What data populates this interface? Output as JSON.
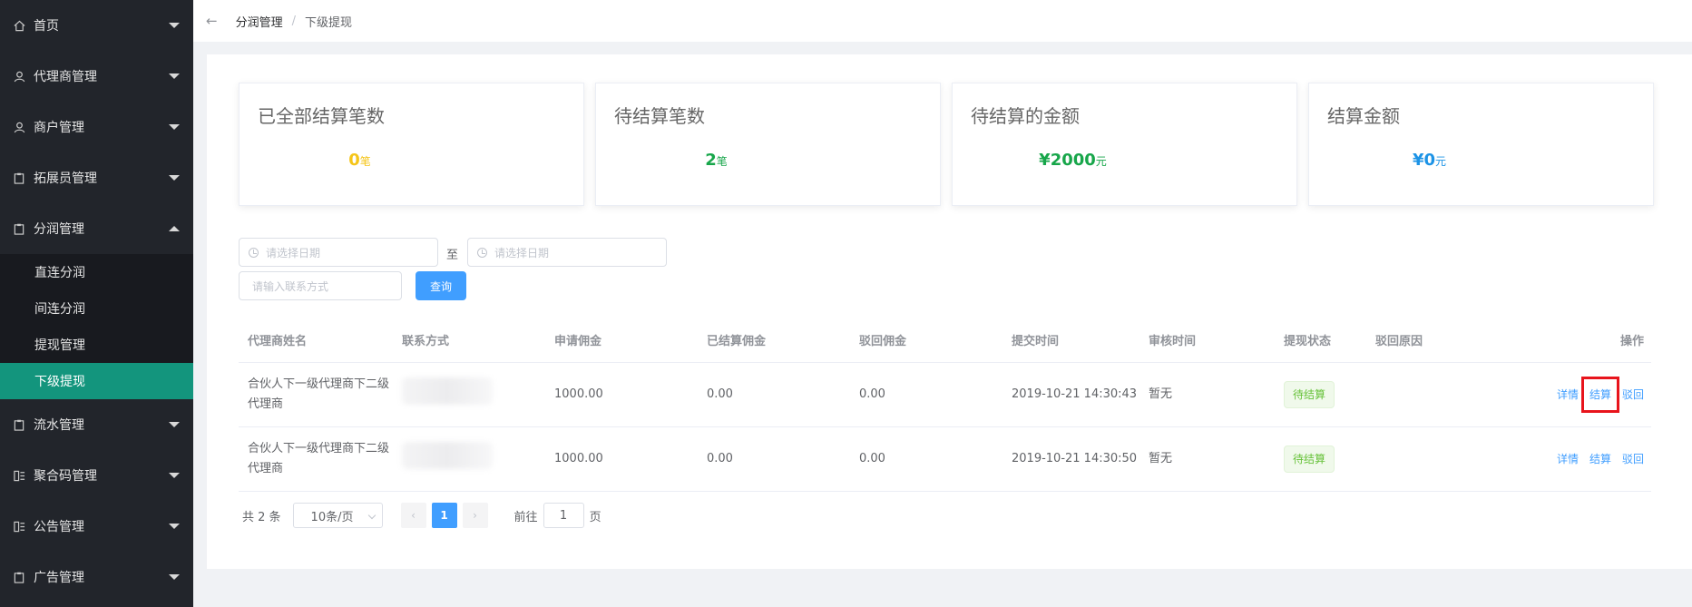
{
  "sidebar": {
    "menu_home": "首页",
    "menu_agent": "代理商管理",
    "menu_merchant": "商户管理",
    "menu_promoter": "拓展员管理",
    "menu_profit": "分润管理",
    "submenu": [
      "直连分润",
      "间连分润",
      "提现管理",
      "下级提现"
    ],
    "menu_flow": "流水管理",
    "menu_qrcode": "聚合码管理",
    "menu_notice": "公告管理",
    "menu_ads": "广告管理"
  },
  "breadcrumb": {
    "back_icon": "←",
    "parent": "分润管理",
    "separator": "/",
    "current": "下级提现"
  },
  "stats": [
    {
      "title": "已全部结算笔数",
      "value": "0",
      "unit": "笔",
      "color": "#f5c518"
    },
    {
      "title": "待结算笔数",
      "value": "2",
      "unit": "笔",
      "color": "#17a64a"
    },
    {
      "title": "待结算的金额",
      "value": "¥2000",
      "unit": "元",
      "color": "#17a64a"
    },
    {
      "title": "结算金额",
      "value": "¥0",
      "unit": "元",
      "color": "#1c93e6"
    }
  ],
  "filters": {
    "start_date_placeholder": "请选择日期",
    "to_label": "至",
    "end_date_placeholder": "请选择日期",
    "contact_placeholder": "请输入联系方式",
    "query_button": "查询"
  },
  "table": {
    "headers": [
      "代理商姓名",
      "联系方式",
      "申请佣金",
      "已结算佣金",
      "驳回佣金",
      "提交时间",
      "审核时间",
      "提现状态",
      "驳回原因",
      "操作"
    ],
    "rows": [
      {
        "name": "合伙人下一级代理商下二级代理商",
        "apply": "1000.00",
        "settled": "0.00",
        "rejected": "0.00",
        "submit_time": "2019-10-21 14:30:43",
        "review_time": "暂无",
        "status": "待结算",
        "reason": "",
        "op_detail": "详情",
        "op_settle": "结算",
        "op_reject": "驳回"
      },
      {
        "name": "合伙人下一级代理商下二级代理商",
        "apply": "1000.00",
        "settled": "0.00",
        "rejected": "0.00",
        "submit_time": "2019-10-21 14:30:50",
        "review_time": "暂无",
        "status": "待结算",
        "reason": "",
        "op_detail": "详情",
        "op_settle": "结算",
        "op_reject": "驳回"
      }
    ]
  },
  "pagination": {
    "total_text": "共 2 条",
    "page_size": "10条/页",
    "prev": "‹",
    "current_page": "1",
    "next": "›",
    "goto_label": "前往",
    "goto_value": "1",
    "page_suffix": "页"
  },
  "colors": {
    "sidebar_bg": "#22252b",
    "active_item": "#13957d",
    "primary": "#409eff",
    "highlight_box": "#e8141c"
  }
}
